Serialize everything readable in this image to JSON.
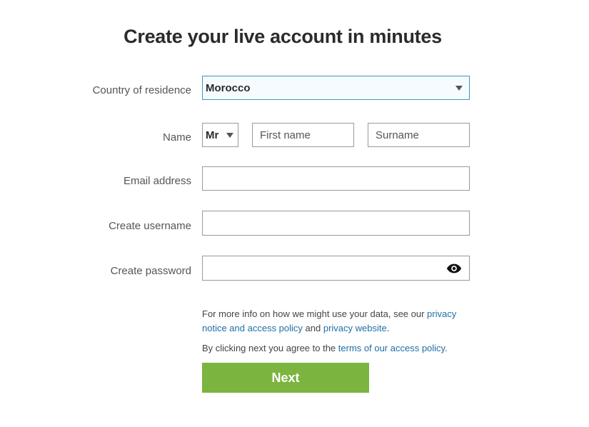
{
  "page": {
    "title": "Create your live account in minutes"
  },
  "form": {
    "country": {
      "label": "Country of residence",
      "value": "Morocco"
    },
    "name": {
      "label": "Name",
      "salutation": "Mr",
      "first_placeholder": "First name",
      "surname_placeholder": "Surname"
    },
    "email": {
      "label": "Email address",
      "value": ""
    },
    "username": {
      "label": "Create username",
      "value": ""
    },
    "password": {
      "label": "Create password",
      "value": "",
      "toggle_icon": "eye-icon"
    }
  },
  "legal": {
    "privacy_prefix": "For more info on how we might use your data, see our ",
    "privacy_link": "privacy notice and access policy",
    "privacy_mid": " and ",
    "privacy_website_link": "privacy website",
    "privacy_suffix": ".",
    "terms_prefix": "By clicking next you agree to the ",
    "terms_link": "terms of our access policy",
    "terms_suffix": "."
  },
  "actions": {
    "next_label": "Next"
  },
  "colors": {
    "accent_button": "#7bb53f",
    "link": "#1f6fa6",
    "focus_border": "#3d9ab5"
  }
}
